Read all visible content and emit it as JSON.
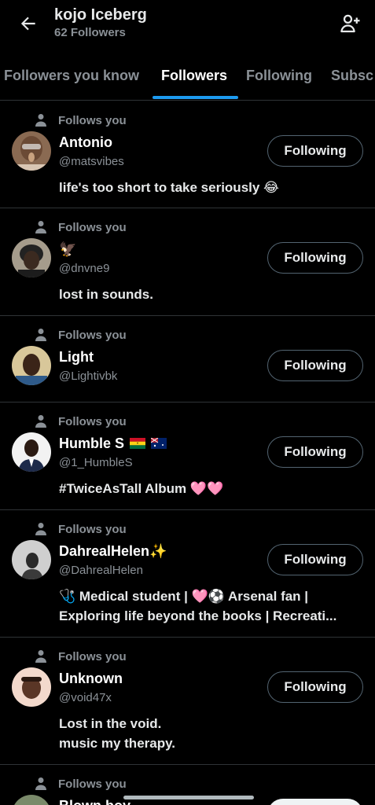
{
  "header": {
    "back_icon": "arrow-left-icon",
    "title": "kojo Iceberg",
    "subtitle": "62 Followers",
    "add_user_icon": "add-user-icon"
  },
  "tabs": [
    {
      "label": "Followers you know",
      "active": false
    },
    {
      "label": "Followers",
      "active": true
    },
    {
      "label": "Following",
      "active": false
    },
    {
      "label": "Subsc",
      "active": false
    }
  ],
  "accent_color": "#1d9bf0",
  "followers": [
    {
      "follows_label": "Follows you",
      "name": "Antonio",
      "handle": "@matsvibes",
      "bio_lines": [
        "life's too short to take seriously 😂"
      ],
      "button_label": "Following"
    },
    {
      "follows_label": "Follows you",
      "name": "🦅",
      "handle": "@dnvne9",
      "bio_lines": [
        "lost in sounds."
      ],
      "button_label": "Following"
    },
    {
      "follows_label": "Follows you",
      "name": "Light",
      "handle": "@Lightivbk",
      "bio_lines": [],
      "button_label": "Following"
    },
    {
      "follows_label": "Follows you",
      "name": "Humble S",
      "handle": "@1_HumbleS",
      "bio_lines": [
        "#TwiceAsTall Album 🩷🩷"
      ],
      "button_label": "Following"
    },
    {
      "follows_label": "Follows you",
      "name": "DahrealHelen✨",
      "handle": "@DahrealHelen",
      "bio_lines": [
        "🩺 Medical student | 🩷⚽ Arsenal fan |",
        "Exploring life beyond the books | Recreati..."
      ],
      "button_label": "Following"
    },
    {
      "follows_label": "Follows you",
      "name": "Unknown",
      "handle": "@void47x",
      "bio_lines": [
        "Lost in the void.",
        "music my therapy."
      ],
      "button_label": "Following"
    },
    {
      "follows_label": "Follows you",
      "name": "Blown boy",
      "handle": "",
      "bio_lines": [],
      "button_label": ""
    }
  ]
}
